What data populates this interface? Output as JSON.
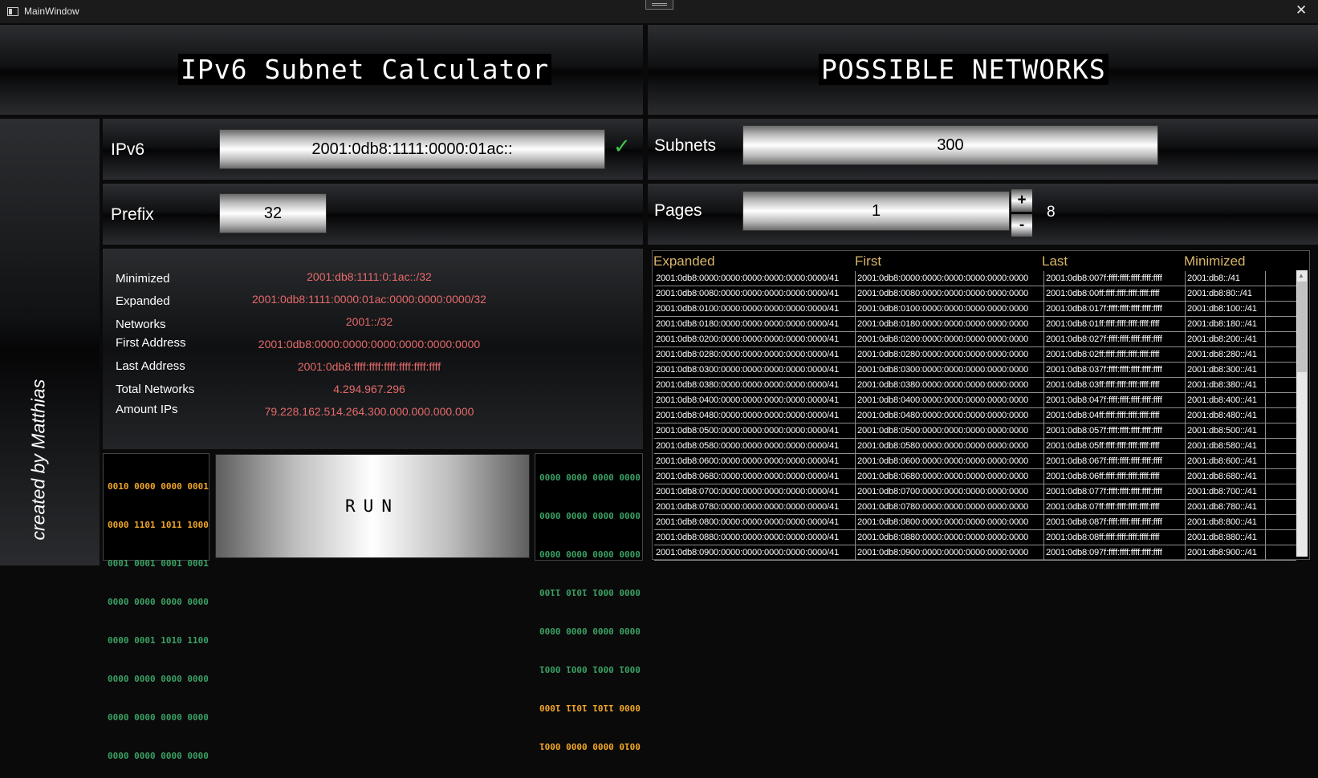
{
  "window": {
    "title": "MainWindow",
    "close": "✕"
  },
  "left_header": {
    "title": "IPv6 Subnet Calculator"
  },
  "right_header": {
    "title": "POSSIBLE NETWORKS"
  },
  "ipv6": {
    "label": "IPv6",
    "value": "2001:0db8:1111:0000:01ac::",
    "valid_icon": "check-icon",
    "check_glyph": "✓"
  },
  "prefix": {
    "label": "Prefix",
    "value": "32"
  },
  "subnets": {
    "label": "Subnets",
    "value": "300"
  },
  "pages": {
    "label": "Pages",
    "value": "1",
    "plus": "+",
    "minus": "-",
    "total": "8"
  },
  "results": [
    {
      "label": "Minimized",
      "value": "2001:db8:1111:0:1ac::/32"
    },
    {
      "label": "Expanded",
      "value": "2001:0db8:1111:0000:01ac:0000:0000:0000/32"
    },
    {
      "label": "Networks",
      "value": "2001::/32"
    },
    {
      "label": "First Address",
      "value": "2001:0db8:0000:0000:0000:0000:0000:0000"
    },
    {
      "label": "Last Address",
      "value": "2001:0db8:ffff:ffff:ffff:ffff:ffff:ffff"
    },
    {
      "label": "Total Networks",
      "value": "4.294.967.296"
    },
    {
      "label": "Amount IPs",
      "value": "79.228.162.514.264.300.000.000.000.000"
    }
  ],
  "binary_left": [
    "0010 0000 0000 0001",
    "0000 1101 1011 1000",
    "0001 0001 0001 0001",
    "0000 0000 0000 0000",
    "0000 0001 1010 1100",
    "0000 0000 0000 0000",
    "0000 0000 0000 0000",
    "0000 0000 0000 0000"
  ],
  "binary_right": [
    "0010 0000 0000 0001",
    "0000 1101 1011 1000",
    "0001 0001 0001 0001",
    "0000 0000 0000 0000",
    "0000 0001 1010 1100",
    "0000 0000 0000 0000",
    "0000 0000 0000 0000",
    "0000 0000 0000 0000"
  ],
  "run": {
    "label": "RUN"
  },
  "signature": "created by Matthias",
  "table": {
    "headers": [
      "Expanded",
      "First",
      "Last",
      "Minimized"
    ],
    "rows": [
      [
        "2001:0db8:0000:0000:0000:0000:0000:0000/41",
        "2001:0db8:0000:0000:0000:0000:0000:0000",
        "2001:0db8:007f:ffff:ffff:ffff:ffff:ffff",
        "2001:db8::/41"
      ],
      [
        "2001:0db8:0080:0000:0000:0000:0000:0000/41",
        "2001:0db8:0080:0000:0000:0000:0000:0000",
        "2001:0db8:00ff:ffff:ffff:ffff:ffff:ffff",
        "2001:db8:80::/41"
      ],
      [
        "2001:0db8:0100:0000:0000:0000:0000:0000/41",
        "2001:0db8:0100:0000:0000:0000:0000:0000",
        "2001:0db8:017f:ffff:ffff:ffff:ffff:ffff",
        "2001:db8:100::/41"
      ],
      [
        "2001:0db8:0180:0000:0000:0000:0000:0000/41",
        "2001:0db8:0180:0000:0000:0000:0000:0000",
        "2001:0db8:01ff:ffff:ffff:ffff:ffff:ffff",
        "2001:db8:180::/41"
      ],
      [
        "2001:0db8:0200:0000:0000:0000:0000:0000/41",
        "2001:0db8:0200:0000:0000:0000:0000:0000",
        "2001:0db8:027f:ffff:ffff:ffff:ffff:ffff",
        "2001:db8:200::/41"
      ],
      [
        "2001:0db8:0280:0000:0000:0000:0000:0000/41",
        "2001:0db8:0280:0000:0000:0000:0000:0000",
        "2001:0db8:02ff:ffff:ffff:ffff:ffff:ffff",
        "2001:db8:280::/41"
      ],
      [
        "2001:0db8:0300:0000:0000:0000:0000:0000/41",
        "2001:0db8:0300:0000:0000:0000:0000:0000",
        "2001:0db8:037f:ffff:ffff:ffff:ffff:ffff",
        "2001:db8:300::/41"
      ],
      [
        "2001:0db8:0380:0000:0000:0000:0000:0000/41",
        "2001:0db8:0380:0000:0000:0000:0000:0000",
        "2001:0db8:03ff:ffff:ffff:ffff:ffff:ffff",
        "2001:db8:380::/41"
      ],
      [
        "2001:0db8:0400:0000:0000:0000:0000:0000/41",
        "2001:0db8:0400:0000:0000:0000:0000:0000",
        "2001:0db8:047f:ffff:ffff:ffff:ffff:ffff",
        "2001:db8:400::/41"
      ],
      [
        "2001:0db8:0480:0000:0000:0000:0000:0000/41",
        "2001:0db8:0480:0000:0000:0000:0000:0000",
        "2001:0db8:04ff:ffff:ffff:ffff:ffff:ffff",
        "2001:db8:480::/41"
      ],
      [
        "2001:0db8:0500:0000:0000:0000:0000:0000/41",
        "2001:0db8:0500:0000:0000:0000:0000:0000",
        "2001:0db8:057f:ffff:ffff:ffff:ffff:ffff",
        "2001:db8:500::/41"
      ],
      [
        "2001:0db8:0580:0000:0000:0000:0000:0000/41",
        "2001:0db8:0580:0000:0000:0000:0000:0000",
        "2001:0db8:05ff:ffff:ffff:ffff:ffff:ffff",
        "2001:db8:580::/41"
      ],
      [
        "2001:0db8:0600:0000:0000:0000:0000:0000/41",
        "2001:0db8:0600:0000:0000:0000:0000:0000",
        "2001:0db8:067f:ffff:ffff:ffff:ffff:ffff",
        "2001:db8:600::/41"
      ],
      [
        "2001:0db8:0680:0000:0000:0000:0000:0000/41",
        "2001:0db8:0680:0000:0000:0000:0000:0000",
        "2001:0db8:06ff:ffff:ffff:ffff:ffff:ffff",
        "2001:db8:680::/41"
      ],
      [
        "2001:0db8:0700:0000:0000:0000:0000:0000/41",
        "2001:0db8:0700:0000:0000:0000:0000:0000",
        "2001:0db8:077f:ffff:ffff:ffff:ffff:ffff",
        "2001:db8:700::/41"
      ],
      [
        "2001:0db8:0780:0000:0000:0000:0000:0000/41",
        "2001:0db8:0780:0000:0000:0000:0000:0000",
        "2001:0db8:07ff:ffff:ffff:ffff:ffff:ffff",
        "2001:db8:780::/41"
      ],
      [
        "2001:0db8:0800:0000:0000:0000:0000:0000/41",
        "2001:0db8:0800:0000:0000:0000:0000:0000",
        "2001:0db8:087f:ffff:ffff:ffff:ffff:ffff",
        "2001:db8:800::/41"
      ],
      [
        "2001:0db8:0880:0000:0000:0000:0000:0000/41",
        "2001:0db8:0880:0000:0000:0000:0000:0000",
        "2001:0db8:08ff:ffff:ffff:ffff:ffff:ffff",
        "2001:db8:880::/41"
      ],
      [
        "2001:0db8:0900:0000:0000:0000:0000:0000/41",
        "2001:0db8:0900:0000:0000:0000:0000:0000",
        "2001:0db8:097f:ffff:ffff:ffff:ffff:ffff",
        "2001:db8:900::/41"
      ]
    ]
  }
}
